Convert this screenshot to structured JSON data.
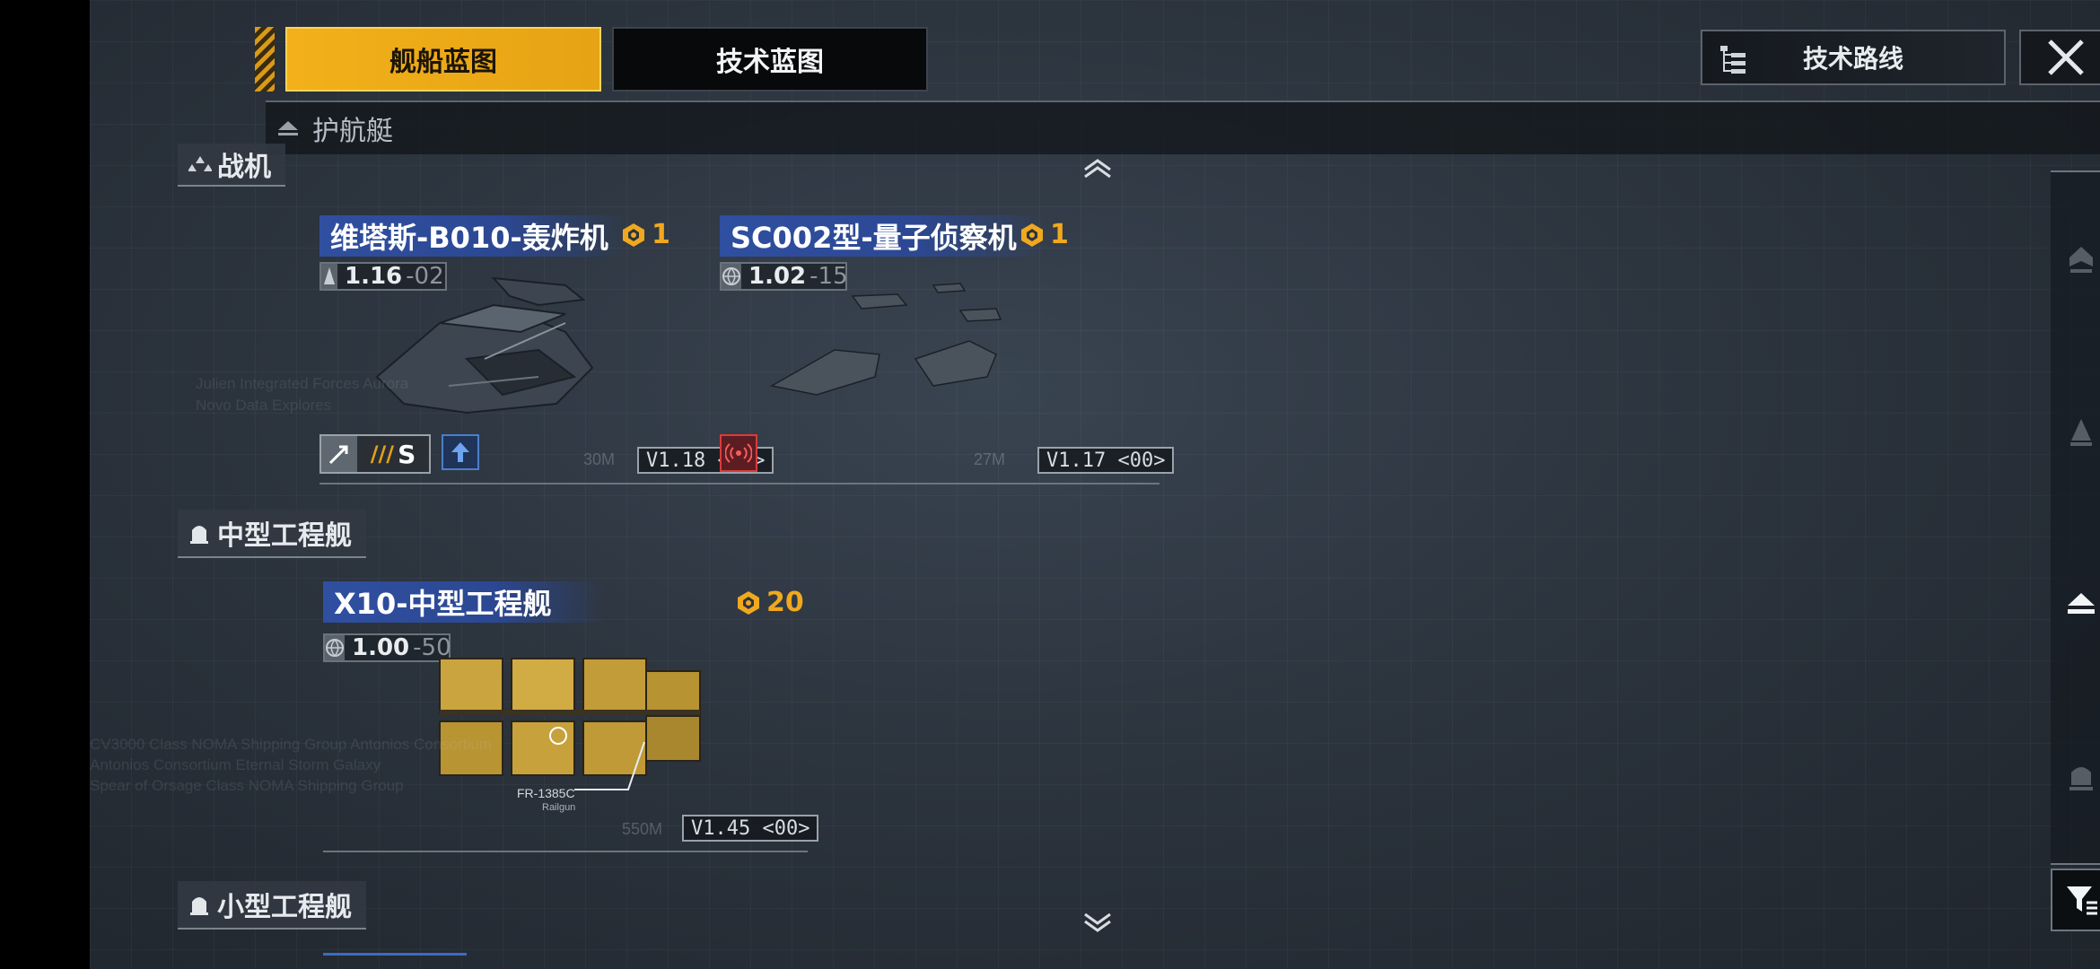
{
  "tabs": {
    "ship_blueprint": "舰船蓝图",
    "tech_blueprint": "技术蓝图"
  },
  "header": {
    "tech_route": "技术路线"
  },
  "category_bar": {
    "label": "护航艇"
  },
  "sections": [
    {
      "label": "战机"
    },
    {
      "label": "中型工程舰"
    },
    {
      "label": "小型工程舰"
    }
  ],
  "ships": [
    {
      "name": "维塔斯-B010-轰炸机",
      "cost": "1",
      "stat_main": "1.16",
      "stat_sub": "-02",
      "range": "30M",
      "version": "V1.18 <00>",
      "role_badge": "S"
    },
    {
      "name": "SC002型-量子侦察机",
      "cost": "1",
      "stat_main": "1.02",
      "stat_sub": "-15",
      "range": "27M",
      "version": "V1.17 <00>"
    },
    {
      "name": "X10-中型工程舰",
      "cost": "20",
      "stat_main": "1.00",
      "stat_sub": "-50",
      "range": "550M",
      "version": "V1.45 <00>",
      "module_label": "FR-1385C",
      "module_sub": "Railgun"
    }
  ],
  "background_text": [
    "Julien Integrated Forces Aurora",
    "Novo Data Explores",
    "CV3000 Class NOMA Shipping Group Antonios Consortium",
    "Antonios Consortium Eternal Storm Galaxy",
    "Spear of Orsage Class NOMA Shipping Group"
  ],
  "colors": {
    "accent": "#f2b01a",
    "ship_name_bg": "#2f4fa0",
    "cost": "#f0a81f",
    "background": "#2c343e"
  },
  "icons": [
    "close-icon",
    "tech-route-icon",
    "chevron-up-icon",
    "chevron-down-icon",
    "filter-icon"
  ]
}
